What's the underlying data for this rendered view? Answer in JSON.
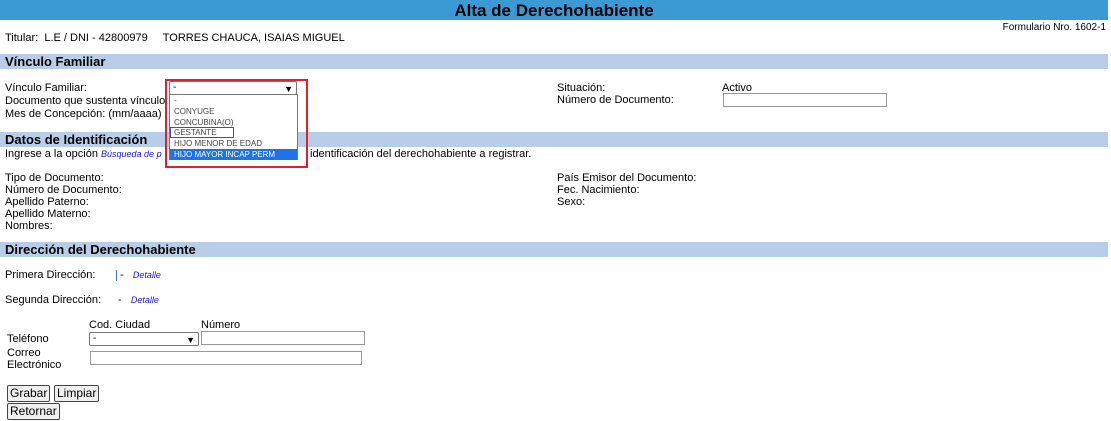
{
  "header": {
    "title": "Alta de Derechohabiente",
    "form_number": "Formulario Nro. 1602-1"
  },
  "titular": {
    "label": "Titular:",
    "document": "L.E / DNI - 42800979",
    "name": "TORRES CHAUCA, ISAIAS MIGUEL"
  },
  "vinculo": {
    "section_title": "Vínculo Familiar",
    "vinculo_label": "Vínculo Familiar:",
    "vinculo_selected": "-",
    "documento_label": "Documento que sustenta vínculo:",
    "mes_label": "Mes de Concepción: (mm/aaaa)",
    "situacion_label": "Situación:",
    "situacion_value": "Activo",
    "numero_doc_label": "Número de Documento:",
    "numero_doc_value": "",
    "options": [
      "-",
      "CONYUGE",
      "CONCUBINA(O)",
      "GESTANTE",
      "HIJO MENOR DE EDAD",
      "HIJO MAYOR INCAP PERM"
    ]
  },
  "identificacion": {
    "section_title": "Datos de Identificación",
    "instruction_prefix": "Ingrese a la opción",
    "instruction_link": "Búsqueda de p",
    "instruction_suffix": "identificación del derechohabiente a registrar.",
    "tipo_doc_label": "Tipo de Documento:",
    "numero_doc_label": "Número de Documento:",
    "apellido_paterno_label": "Apellido Paterno:",
    "apellido_materno_label": "Apellido Materno:",
    "nombres_label": "Nombres:",
    "pais_emisor_label": "País Emisor del Documento:",
    "fec_nacimiento_label": "Fec. Nacimiento:",
    "sexo_label": "Sexo:"
  },
  "direccion": {
    "section_title": "Dirección del Derechohabiente",
    "primera_label": "Primera Dirección:",
    "primera_value": "-",
    "segunda_label": "Segunda Dirección:",
    "segunda_value": "-",
    "detalle_link": "Detalle",
    "cod_ciudad_label": "Cod. Ciudad",
    "numero_label": "Número",
    "telefono_label": "Teléfono",
    "cod_ciudad_selected": "-",
    "telefono_value": "",
    "correo_label_1": "Correo",
    "correo_label_2": "Electrónico",
    "correo_value": ""
  },
  "buttons": {
    "grabar": "Grabar",
    "limpiar": "Limpiar",
    "retornar": "Retornar"
  }
}
